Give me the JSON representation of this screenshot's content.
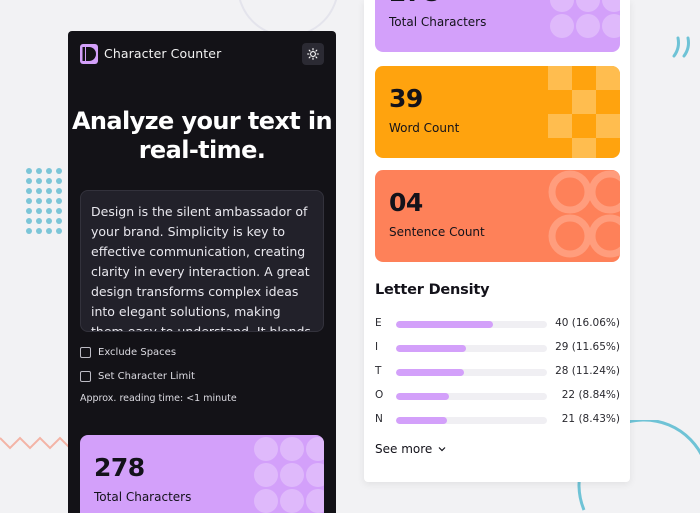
{
  "app": {
    "title": "Character Counter"
  },
  "hero": {
    "headline_line1": "Analyze your text in",
    "headline_line2": "real-time."
  },
  "input": {
    "text": "Design is the silent ambassador of your brand. Simplicity is key to effective communication, creating clarity in every interaction. A great design transforms complex ideas into elegant solutions, making them easy to understand. It blends"
  },
  "options": {
    "exclude_spaces": "Exclude Spaces",
    "char_limit": "Set Character Limit",
    "reading_time": "Approx. reading time: <1 minute"
  },
  "stats": {
    "total_characters": {
      "value": "278",
      "label": "Total Characters",
      "color": "#d3a0fa"
    },
    "word_count": {
      "value": "39",
      "label": "Word Count",
      "color": "#ffa30e"
    },
    "sentence_count": {
      "value": "04",
      "label": "Sentence Count",
      "color": "#fe8159"
    }
  },
  "density": {
    "title": "Letter Density",
    "rows": [
      {
        "letter": "E",
        "value": "40 (16.06%)",
        "percent": 16.06
      },
      {
        "letter": "I",
        "value": "29 (11.65%)",
        "percent": 11.65
      },
      {
        "letter": "T",
        "value": "28 (11.24%)",
        "percent": 11.24
      },
      {
        "letter": "O",
        "value": "22 (8.84%)",
        "percent": 8.84
      },
      {
        "letter": "N",
        "value": "21 (8.43%)",
        "percent": 8.43
      }
    ],
    "see_more": "See more"
  },
  "colors": {
    "accent_purple": "#d3a0fa",
    "accent_orange": "#ffa30e",
    "accent_coral": "#fe8159",
    "dark_bg": "#131217"
  }
}
